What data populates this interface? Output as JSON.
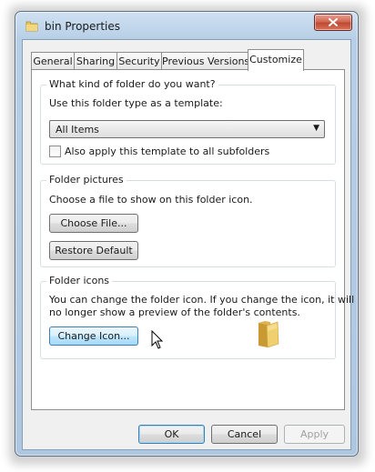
{
  "window": {
    "title": "bin Properties"
  },
  "tabs": [
    {
      "label": "General"
    },
    {
      "label": "Sharing"
    },
    {
      "label": "Security"
    },
    {
      "label": "Previous Versions"
    },
    {
      "label": "Customize"
    }
  ],
  "template_group": {
    "legend": "What kind of folder do you want?",
    "prompt": "Use this folder type as a template:",
    "selected": "All Items",
    "checkbox_label": "Also apply this template to all subfolders",
    "checkbox_checked": false
  },
  "pictures_group": {
    "legend": "Folder pictures",
    "prompt": "Choose a file to show on this folder icon.",
    "choose_file": "Choose File...",
    "restore_default": "Restore Default"
  },
  "icons_group": {
    "legend": "Folder icons",
    "line1": "You can change the folder icon. If you change the icon, it will",
    "line2": "no longer show a preview of the folder's contents.",
    "change_icon": "Change Icon..."
  },
  "footer": {
    "ok": "OK",
    "cancel": "Cancel",
    "apply": "Apply"
  },
  "colors": {
    "accent": "#3c7fb1",
    "close": "#c04a33",
    "folder": "#e8c25a"
  }
}
